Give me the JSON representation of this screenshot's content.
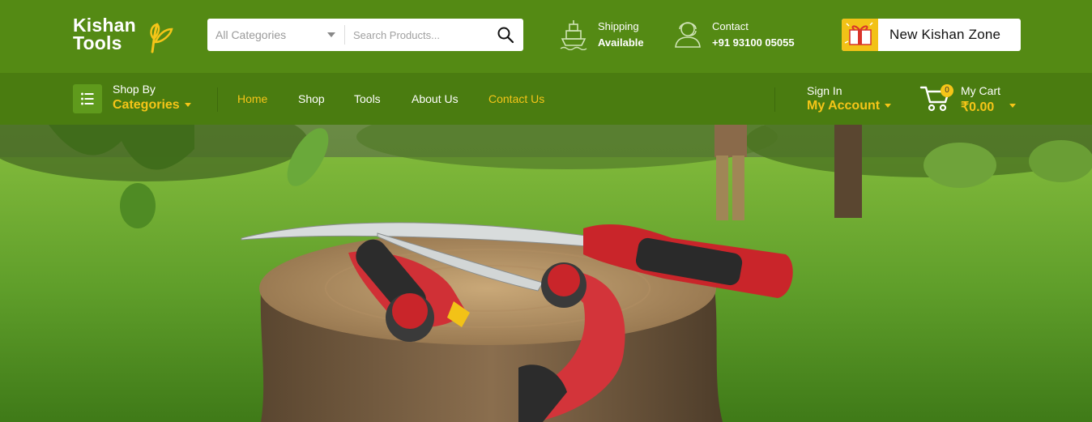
{
  "brand": {
    "logo_line1": "Kishan",
    "logo_line2": "Tools"
  },
  "search": {
    "category_label": "All Categories",
    "placeholder": "Search Products...",
    "icon": "search-icon"
  },
  "header_info": {
    "shipping": {
      "line1": "Shipping",
      "line2": "Available",
      "icon": "ship-icon"
    },
    "contact": {
      "line1": "Contact",
      "line2": "+91 93100 05055",
      "icon": "support-agent-icon"
    }
  },
  "zone_button": {
    "label": "New Kishan Zone",
    "icon": "gift-icon"
  },
  "nav": {
    "shop_by": "Shop By",
    "categories": "Categories",
    "links": [
      {
        "label": "Home",
        "active": true
      },
      {
        "label": "Shop",
        "active": false
      },
      {
        "label": "Tools",
        "active": false
      },
      {
        "label": "About Us",
        "active": false
      },
      {
        "label": "Contact Us",
        "active": true
      }
    ],
    "sign_in": "Sign In",
    "my_account": "My Account",
    "cart_count": "0",
    "cart_title": "My Cart",
    "cart_total": "₹0.00"
  },
  "colors": {
    "header_green": "#548a14",
    "nav_green": "#4a7c10",
    "accent_yellow": "#f5c518"
  }
}
